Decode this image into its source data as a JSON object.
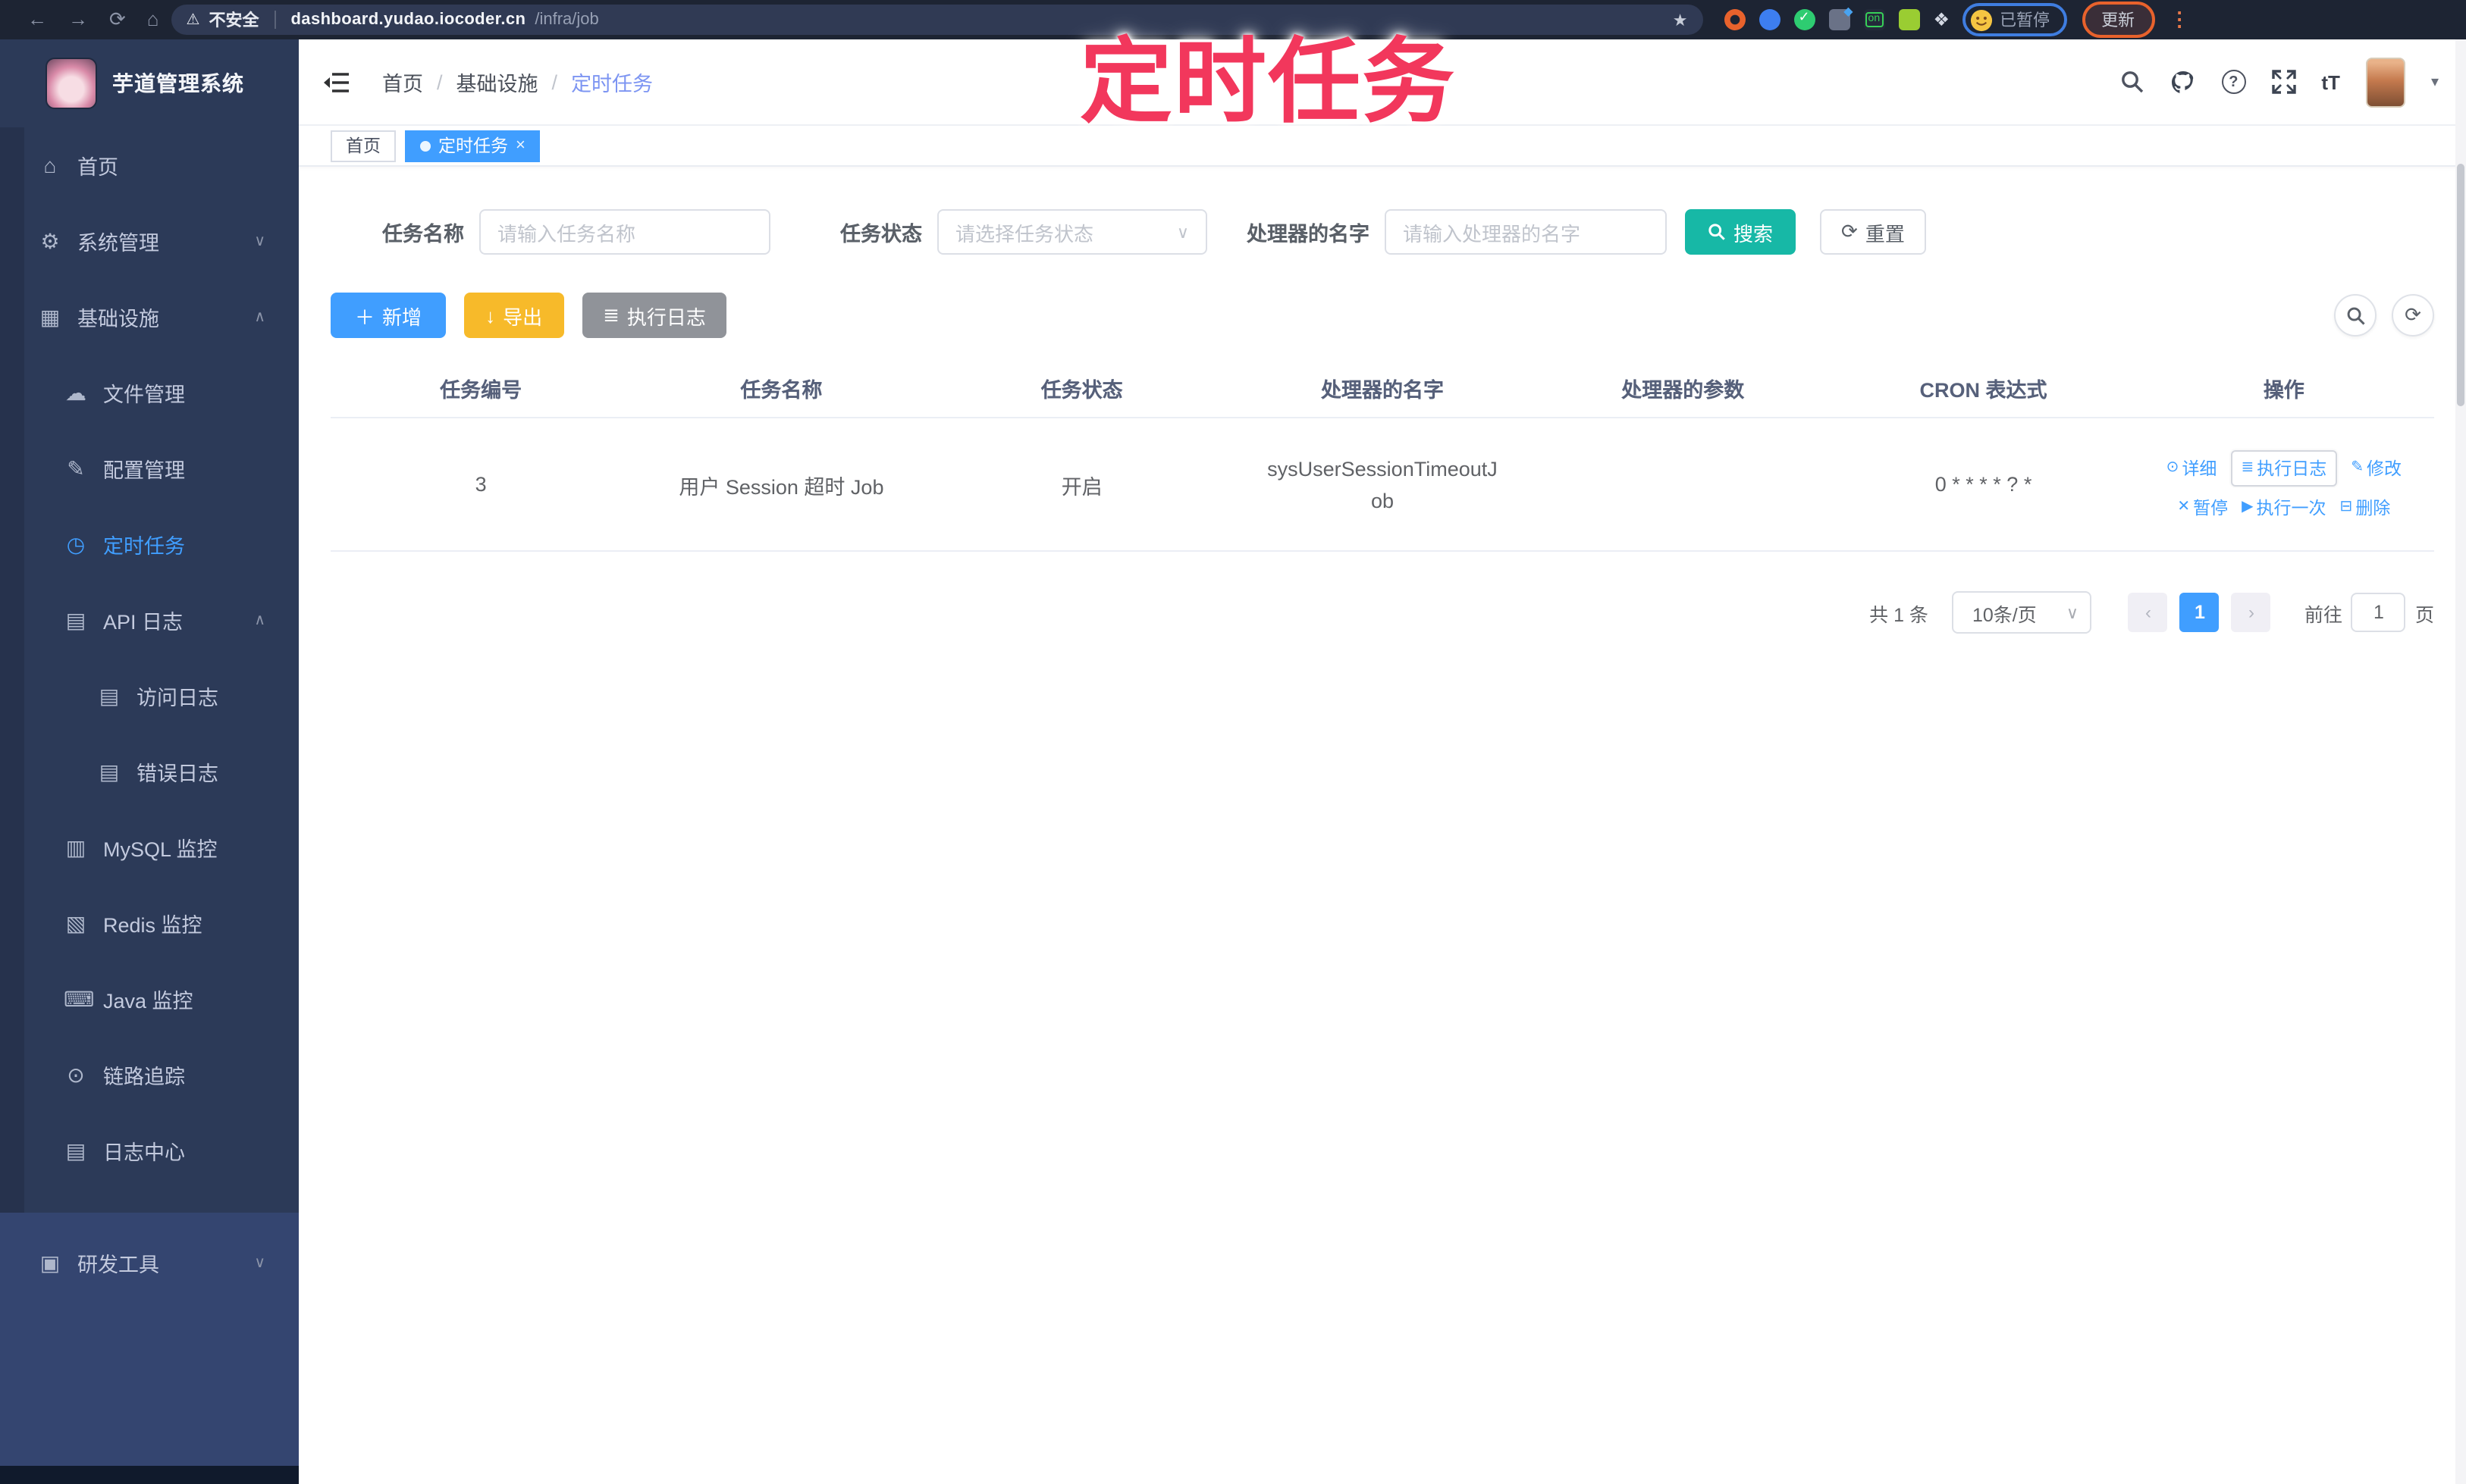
{
  "colors": {
    "accent": "#409eff",
    "search_teal": "#17b8a6",
    "export_orange": "#f7ba2a",
    "exec_gray": "#909399",
    "sidebar_bg": "#2c3a58",
    "annotation_pink": "#f2375c",
    "active_tab": "#409eff"
  },
  "icons": {
    "back": "←",
    "forward": "→",
    "reload": "⟳",
    "home": "⌂",
    "warning": "⚠",
    "star": "★",
    "puzzle": "❖",
    "kebab": "⋮",
    "chevron_down": "∨",
    "chevron_up": "∧",
    "caret_down": "▾",
    "select_arrow": "∨",
    "plus": "＋",
    "download": "↓",
    "list": "≣",
    "refresh": "⟳",
    "question": "?",
    "text_size": "tT",
    "menu_home": "⌂",
    "menu_gear": "⚙",
    "menu_infra": "▦",
    "menu_cloud": "☁",
    "menu_edit": "✎",
    "menu_timer": "◷",
    "menu_log": "▤",
    "menu_mysql": "▥",
    "menu_redis": "▧",
    "menu_java": "⌨",
    "menu_trace": "⊙",
    "menu_logcenter": "▤",
    "menu_tools": "▣",
    "act_eye": "⊙",
    "act_list": "≣",
    "act_edit": "✎",
    "act_close": "✕",
    "act_play": "▶",
    "act_delete": "⊟",
    "tab_dot": "●",
    "tab_close": "×",
    "prev": "‹",
    "next": "›"
  },
  "browser": {
    "security_warning": "不安全",
    "url_domain": "dashboard.yudao.iocoder.cn",
    "url_path": "/infra/job",
    "paused_badge": "已暂停",
    "update_button": "更新"
  },
  "annotation": {
    "title": "定时任务"
  },
  "sidebar": {
    "app_title": "芋道管理系统",
    "items": [
      {
        "label": "首页",
        "level": 1
      },
      {
        "label": "系统管理",
        "level": 1,
        "arrow": "down"
      },
      {
        "label": "基础设施",
        "level": 1,
        "arrow": "up"
      },
      {
        "label": "文件管理",
        "level": 2
      },
      {
        "label": "配置管理",
        "level": 2
      },
      {
        "label": "定时任务",
        "level": 2,
        "active": true
      },
      {
        "label": "API 日志",
        "level": 2,
        "arrow": "up"
      },
      {
        "label": "访问日志",
        "level": 3
      },
      {
        "label": "错误日志",
        "level": 3
      },
      {
        "label": "MySQL 监控",
        "level": 2
      },
      {
        "label": "Redis 监控",
        "level": 2
      },
      {
        "label": "Java 监控",
        "level": 2
      },
      {
        "label": "链路追踪",
        "level": 2
      },
      {
        "label": "日志中心",
        "level": 2
      },
      {
        "label": "研发工具",
        "level": 1,
        "arrow": "down"
      }
    ]
  },
  "breadcrumb": {
    "items": [
      "首页",
      "基础设施",
      "定时任务"
    ]
  },
  "tabs": [
    {
      "label": "首页",
      "active": false
    },
    {
      "label": "定时任务",
      "active": true
    }
  ],
  "filters": {
    "name_label": "任务名称",
    "name_placeholder": "请输入任务名称",
    "status_label": "任务状态",
    "status_placeholder": "请选择任务状态",
    "handler_label": "处理器的名字",
    "handler_placeholder": "请输入处理器的名字",
    "search_label": "搜索",
    "reset_label": "重置"
  },
  "toolbar": {
    "add_label": "新增",
    "export_label": "导出",
    "exec_log_label": "执行日志"
  },
  "table": {
    "headers": [
      "任务编号",
      "任务名称",
      "任务状态",
      "处理器的名字",
      "处理器的参数",
      "CRON 表达式",
      "操作"
    ],
    "rows": [
      {
        "id": "3",
        "name": "用户 Session 超时 Job",
        "status": "开启",
        "handler": "sysUserSessionTimeoutJob",
        "param": "",
        "cron": "0 * * * * ? *"
      }
    ],
    "actions": {
      "detail": "详细",
      "exec_log": "执行日志",
      "edit": "修改",
      "pause": "暂停",
      "run_once": "执行一次",
      "delete": "删除"
    }
  },
  "pagination": {
    "total": "共 1 条",
    "page_size": "10条/页",
    "current_page": "1",
    "goto_label": "前往",
    "goto_value": "1",
    "page_unit": "页"
  }
}
